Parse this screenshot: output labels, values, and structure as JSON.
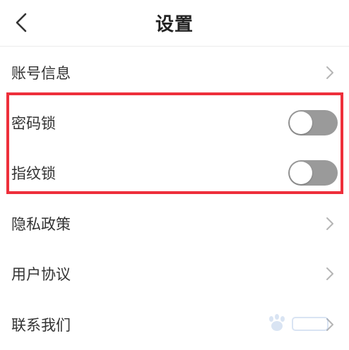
{
  "header": {
    "title": "设置",
    "back_icon": "chevron-left-icon"
  },
  "rows": [
    {
      "label": "账号信息",
      "control": "chevron"
    },
    {
      "label": "密码锁",
      "control": "toggle",
      "value": false
    },
    {
      "label": "指纹锁",
      "control": "toggle",
      "value": false
    },
    {
      "label": "隐私政策",
      "control": "chevron"
    },
    {
      "label": "用户协议",
      "control": "chevron"
    },
    {
      "label": "联系我们",
      "control": "chevron"
    }
  ],
  "colors": {
    "highlight": "#ee2f3b",
    "toggle_off": "#9a9a9a"
  }
}
